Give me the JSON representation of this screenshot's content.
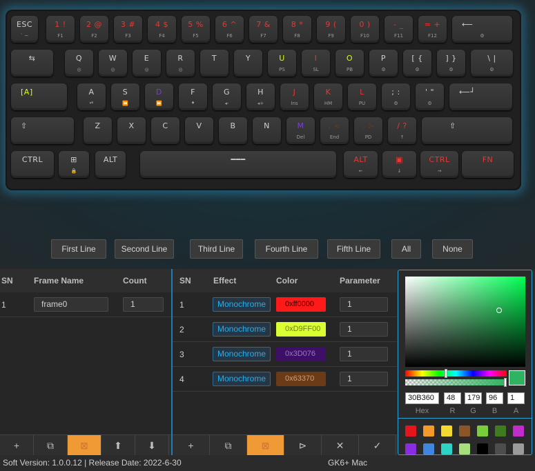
{
  "keyboard": {
    "rows": [
      [
        {
          "top": "ESC",
          "sub": "` ~",
          "tc": "#d0d0d0"
        },
        {
          "top": "1 !",
          "sub": "F1",
          "tc": "#e53935"
        },
        {
          "top": "2 @",
          "sub": "F2",
          "tc": "#e53935"
        },
        {
          "top": "3 #",
          "sub": "F3",
          "tc": "#e53935"
        },
        {
          "top": "4 $",
          "sub": "F4",
          "tc": "#e53935"
        },
        {
          "top": "5 %",
          "sub": "F5",
          "tc": "#e53935"
        },
        {
          "top": "6 ^",
          "sub": "F6",
          "tc": "#e53935"
        },
        {
          "top": "7 &",
          "sub": "F7",
          "tc": "#e53935"
        },
        {
          "top": "8 *",
          "sub": "F8",
          "tc": "#e53935"
        },
        {
          "top": "9 (",
          "sub": "F9",
          "tc": "#e53935"
        },
        {
          "top": "0 )",
          "sub": "F10",
          "tc": "#e53935"
        },
        {
          "top": "- _",
          "sub": "F11",
          "tc": "#e53935"
        },
        {
          "top": "= +",
          "sub": "F12",
          "tc": "#e53935"
        },
        {
          "top": "⟵",
          "sub": "⚙",
          "tc": "#d0d0d0"
        }
      ],
      [
        {
          "top": "⇆",
          "sub": "",
          "tc": "#d0d0d0"
        },
        {
          "top": "Q",
          "sub": "◎",
          "tc": "#d0d0d0"
        },
        {
          "top": "W",
          "sub": "◎",
          "tc": "#d0d0d0"
        },
        {
          "top": "E",
          "sub": "◎",
          "tc": "#d0d0d0"
        },
        {
          "top": "R",
          "sub": "◎",
          "tc": "#d0d0d0"
        },
        {
          "top": "T",
          "sub": "",
          "tc": "#d0d0d0"
        },
        {
          "top": "Y",
          "sub": "",
          "tc": "#d0d0d0"
        },
        {
          "top": "U",
          "sub": "PS",
          "tc": "#d9ff00"
        },
        {
          "top": "I",
          "sub": "SL",
          "tc": "#e53935"
        },
        {
          "top": "O",
          "sub": "PB",
          "tc": "#d9ff00"
        },
        {
          "top": "P",
          "sub": "⚙",
          "tc": "#d0d0d0"
        },
        {
          "top": "[ {",
          "sub": "⚙",
          "tc": "#d0d0d0"
        },
        {
          "top": "] }",
          "sub": "⚙",
          "tc": "#d0d0d0"
        },
        {
          "top": "\\ |",
          "sub": "⚙",
          "tc": "#d0d0d0"
        }
      ],
      [
        {
          "top": "[A]",
          "sub": "",
          "tc": "#d9ff00"
        },
        {
          "top": "A",
          "sub": "⏯",
          "tc": "#d0d0d0"
        },
        {
          "top": "S",
          "sub": "⏪",
          "tc": "#d0d0d0"
        },
        {
          "top": "D",
          "sub": "⏩",
          "tc": "#7a3fd0"
        },
        {
          "top": "F",
          "sub": "⏺",
          "tc": "#d0d0d0"
        },
        {
          "top": "G",
          "sub": "◂-",
          "tc": "#d0d0d0"
        },
        {
          "top": "H",
          "sub": "◂+",
          "tc": "#d0d0d0"
        },
        {
          "top": "J",
          "sub": "Ins",
          "tc": "#e53935"
        },
        {
          "top": "K",
          "sub": "HM",
          "tc": "#e53935"
        },
        {
          "top": "L",
          "sub": "PU",
          "tc": "#e53935"
        },
        {
          "top": "; :",
          "sub": "⚙",
          "tc": "#d0d0d0"
        },
        {
          "top": "' \"",
          "sub": "⚙",
          "tc": "#d0d0d0"
        },
        {
          "top": "⟵┘",
          "sub": "",
          "tc": "#d0d0d0"
        }
      ],
      [
        {
          "top": "⇧",
          "sub": "",
          "tc": "#d0d0d0"
        },
        {
          "top": "Z",
          "sub": "",
          "tc": "#d0d0d0"
        },
        {
          "top": "X",
          "sub": "",
          "tc": "#d0d0d0"
        },
        {
          "top": "C",
          "sub": "",
          "tc": "#d0d0d0"
        },
        {
          "top": "V",
          "sub": "",
          "tc": "#d0d0d0"
        },
        {
          "top": "B",
          "sub": "",
          "tc": "#d0d0d0"
        },
        {
          "top": "N",
          "sub": "",
          "tc": "#d0d0d0"
        },
        {
          "top": "M",
          "sub": "Del",
          "tc": "#7a3fd0"
        },
        {
          "top": ", <",
          "sub": "End",
          "tc": "#6a3a1a"
        },
        {
          "top": ". >",
          "sub": "PD",
          "tc": "#6a3a1a"
        },
        {
          "top": "/ ?",
          "sub": "↑",
          "tc": "#e53935"
        },
        {
          "top": "⇧",
          "sub": "",
          "tc": "#d0d0d0"
        }
      ],
      [
        {
          "top": "CTRL",
          "sub": "",
          "tc": "#d0d0d0"
        },
        {
          "top": "⊞",
          "sub": "🔒",
          "tc": "#d0d0d0"
        },
        {
          "top": "ALT",
          "sub": "",
          "tc": "#d0d0d0"
        },
        {
          "top": "━━━",
          "sub": "",
          "tc": "#d0d0d0"
        },
        {
          "top": "ALT",
          "sub": "←",
          "tc": "#e53935"
        },
        {
          "top": "▣",
          "sub": "↓",
          "tc": "#e53935"
        },
        {
          "top": "CTRL",
          "sub": "→",
          "tc": "#e53935"
        },
        {
          "top": "FN",
          "sub": "",
          "tc": "#e53935"
        }
      ]
    ]
  },
  "line_buttons": [
    "First Line",
    "Second Line",
    "Third Line",
    "Fourth Line",
    "Fifth Line",
    "All",
    "None"
  ],
  "frames": {
    "headers": {
      "sn": "SN",
      "name": "Frame Name",
      "count": "Count"
    },
    "rows": [
      {
        "sn": "1",
        "name": "frame0",
        "count": "1"
      }
    ],
    "toolbar": [
      {
        "icon": "plus-icon",
        "glyph": "+",
        "active": false
      },
      {
        "icon": "copy-icon",
        "glyph": "⧉",
        "active": false
      },
      {
        "icon": "delete-icon",
        "glyph": "⊠",
        "active": true
      },
      {
        "icon": "arrow-up-icon",
        "glyph": "⬆",
        "active": false
      },
      {
        "icon": "arrow-down-icon",
        "glyph": "⬇",
        "active": false
      }
    ]
  },
  "effects": {
    "headers": {
      "sn": "SN",
      "effect": "Effect",
      "color": "Color",
      "param": "Parameter"
    },
    "rows": [
      {
        "sn": "1",
        "effect": "Monochrome",
        "color_text": "0xff0000",
        "color_bg": "#ff1a1a",
        "color_fg": "#2a0000",
        "param": "1"
      },
      {
        "sn": "2",
        "effect": "Monochrome",
        "color_text": "0xD9FF00",
        "color_bg": "#d9ff33",
        "color_fg": "#707c24",
        "param": "1"
      },
      {
        "sn": "3",
        "effect": "Monochrome",
        "color_text": "0x3D076",
        "color_bg": "#3d0f66",
        "color_fg": "#9a7ac0",
        "param": "1"
      },
      {
        "sn": "4",
        "effect": "Monochrome",
        "color_text": "0x63370",
        "color_bg": "#6b3a16",
        "color_fg": "#c9a07a",
        "param": "1"
      }
    ],
    "toolbar": [
      {
        "icon": "plus-icon",
        "glyph": "+",
        "active": false
      },
      {
        "icon": "copy-icon",
        "glyph": "⧉",
        "active": false
      },
      {
        "icon": "delete-icon",
        "glyph": "⊠",
        "active": true
      },
      {
        "icon": "play-icon",
        "glyph": "⊳",
        "active": false
      },
      {
        "icon": "close-icon",
        "glyph": "✕",
        "active": false
      },
      {
        "icon": "check-icon",
        "glyph": "✓",
        "active": false
      }
    ]
  },
  "picker": {
    "hex": "30B360",
    "r": "48",
    "g": "179",
    "b": "96",
    "a": "1",
    "labels": {
      "hex": "Hex",
      "r": "R",
      "g": "G",
      "b": "B",
      "a": "A"
    },
    "hue_fraction": 0.4,
    "alpha_fraction": 1.0,
    "current_color": "#30b360",
    "swatches": [
      "#e5151f",
      "#f39a2b",
      "#f3d92f",
      "#8a5529",
      "#77cd3a",
      "#3f7c20",
      "#c22ccb",
      "#8a2ce3",
      "#3e86e0",
      "#2ed3c7",
      "#a6e07c",
      "#000000",
      "#4d4d4d",
      "#9b9b9b"
    ]
  },
  "status": {
    "version": "Soft Version: 1.0.0.12 | Release Date: 2022-6-30",
    "device": "GK6+ Mac"
  }
}
